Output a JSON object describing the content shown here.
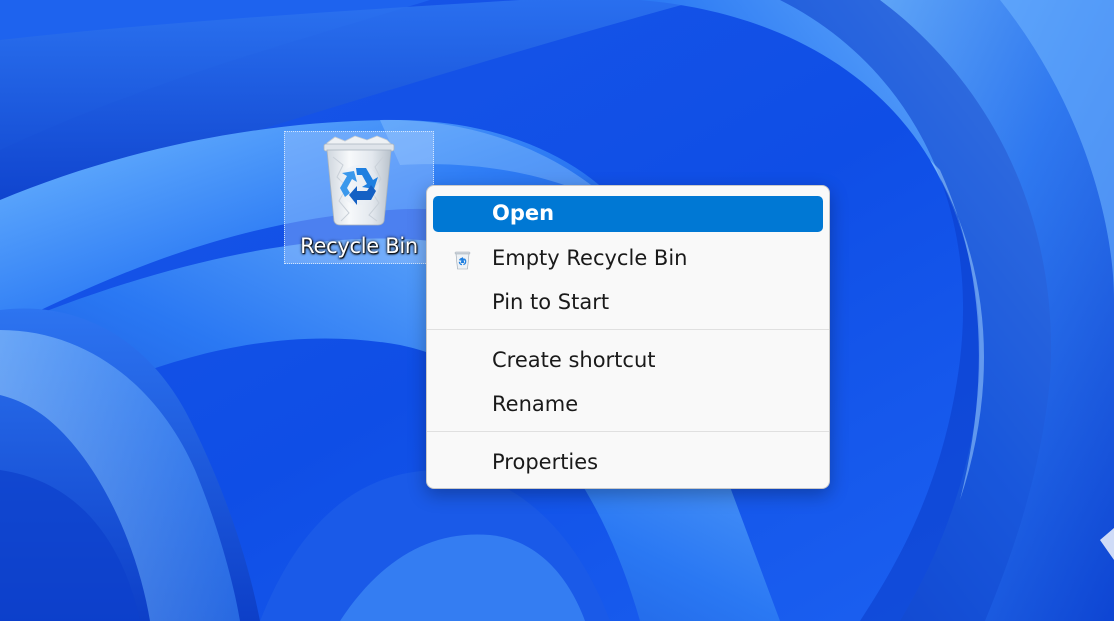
{
  "desktop": {
    "wallpaper": "windows-11-bloom",
    "accent_color": "#0078d4",
    "icons": [
      {
        "label": "Recycle Bin",
        "icon": "recycle-bin-icon",
        "selected": true
      }
    ]
  },
  "context_menu": {
    "groups": [
      [
        {
          "label": "Open",
          "highlighted": true
        },
        {
          "label": "Empty Recycle Bin",
          "icon": "recycle-bin-small-icon"
        },
        {
          "label": "Pin to Start"
        }
      ],
      [
        {
          "label": "Create shortcut"
        },
        {
          "label": "Rename"
        }
      ],
      [
        {
          "label": "Properties"
        }
      ]
    ]
  }
}
